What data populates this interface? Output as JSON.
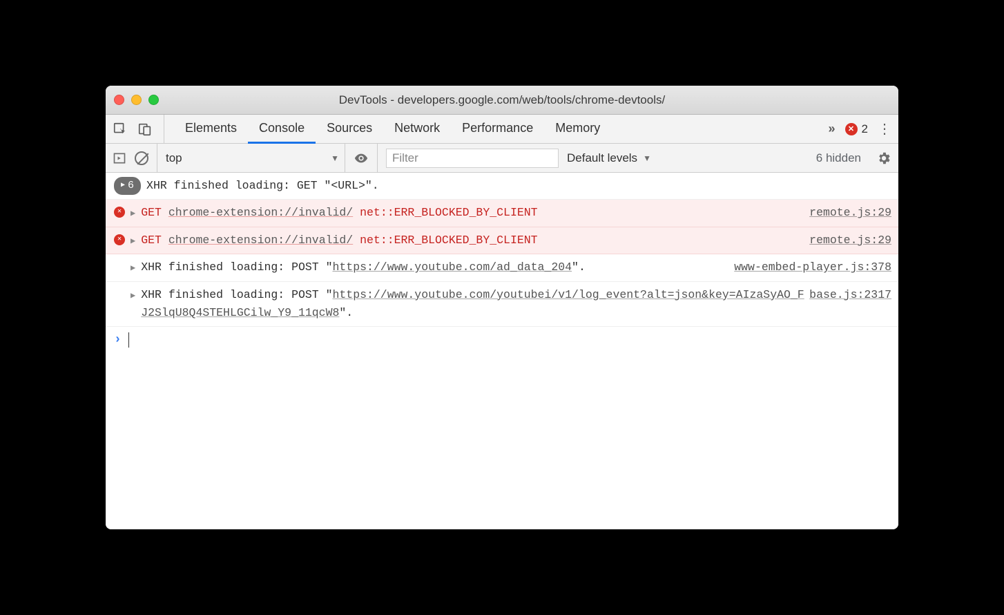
{
  "window": {
    "title": "DevTools - developers.google.com/web/tools/chrome-devtools/"
  },
  "tabs": {
    "items": [
      "Elements",
      "Console",
      "Sources",
      "Network",
      "Performance",
      "Memory"
    ],
    "active_index": 1,
    "error_count": "2"
  },
  "toolbar": {
    "context": "top",
    "filter_placeholder": "Filter",
    "levels": "Default levels",
    "hidden": "6 hidden"
  },
  "logs": {
    "badge_count": "6",
    "row0": "XHR finished loading: GET \"<URL>\".",
    "err_method": "GET",
    "err_url": "chrome-extension://invalid/",
    "err_code": "net::ERR_BLOCKED_BY_CLIENT",
    "err_source": "remote.js:29",
    "row3_prefix": "XHR finished loading: POST \"",
    "row3_url": "https://www.youtube.com/ad_data_204",
    "row3_suffix": "\".",
    "row3_source": "www-embed-player.js:378",
    "row4_prefix": "XHR finished loading: POST \"",
    "row4_url": "https://www.youtube.com/youtubei/v1/log_event?alt=json&key=AIzaSyAO_FJ2SlqU8Q4STEHLGCilw_Y9_11qcW8",
    "row4_suffix": "\".",
    "row4_source": "base.js:2317"
  }
}
